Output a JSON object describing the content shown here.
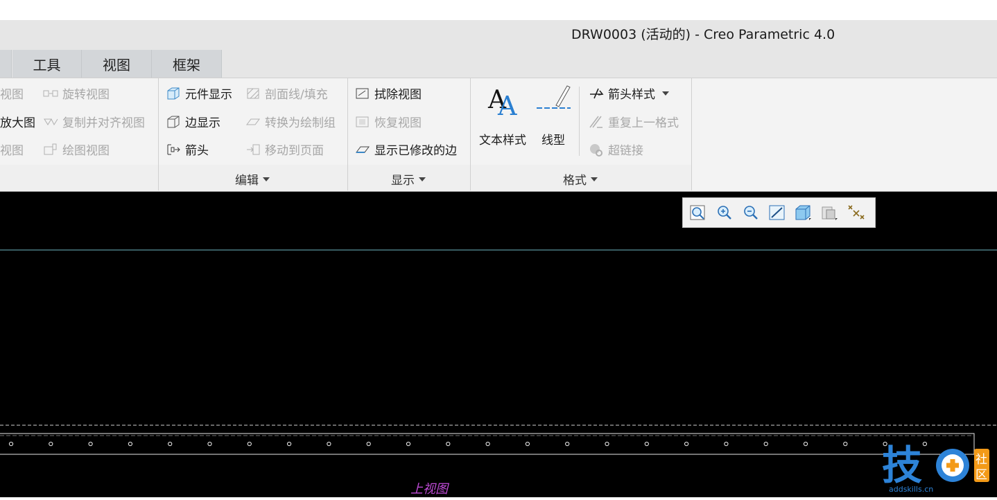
{
  "window": {
    "title": "DRW0003 (活动的) - Creo Parametric 4.0"
  },
  "tabs": [
    {
      "label": "工具"
    },
    {
      "label": "视图"
    },
    {
      "label": "框架"
    }
  ],
  "ribbon": {
    "col1": [
      {
        "label": "视图",
        "enabled": false
      },
      {
        "label": "放大图",
        "enabled": true
      },
      {
        "label": "视图",
        "enabled": false
      }
    ],
    "col2": [
      {
        "label": "旋转视图",
        "enabled": false
      },
      {
        "label": "复制并对齐视图",
        "enabled": false
      },
      {
        "label": "绘图视图",
        "enabled": false
      }
    ],
    "edit": {
      "group_label": "编辑",
      "items": [
        {
          "label": "元件显示",
          "enabled": true
        },
        {
          "label": "边显示",
          "enabled": true
        },
        {
          "label": "箭头",
          "enabled": true
        },
        {
          "label": "剖面线/填充",
          "enabled": false
        },
        {
          "label": "转换为绘制组",
          "enabled": false
        },
        {
          "label": "移动到页面",
          "enabled": false
        }
      ]
    },
    "display": {
      "group_label": "显示",
      "items": [
        {
          "label": "拭除视图",
          "enabled": true
        },
        {
          "label": "恢复视图",
          "enabled": false
        },
        {
          "label": "显示已修改的边",
          "enabled": true
        }
      ]
    },
    "format": {
      "group_label": "格式",
      "text_style": "文本样式",
      "line_style": "线型",
      "items": [
        {
          "label": "箭头样式",
          "enabled": true
        },
        {
          "label": "重复上一格式",
          "enabled": false
        },
        {
          "label": "超链接",
          "enabled": false
        }
      ]
    }
  },
  "view_toolbar": {
    "buttons": [
      "zoom-window-icon",
      "zoom-in-icon",
      "zoom-out-icon",
      "repaint-icon",
      "display-style-icon",
      "saved-orientations-icon",
      "datum-display-icon"
    ]
  },
  "drawing": {
    "view_label": "上视图",
    "hole_count": 24
  },
  "watermark": {
    "glyph": "技",
    "side": "社区",
    "url": "addskills.cn"
  },
  "colors": {
    "canvas": "#000000",
    "view_label": "#c04bd8",
    "accent": "#2d83d8"
  }
}
